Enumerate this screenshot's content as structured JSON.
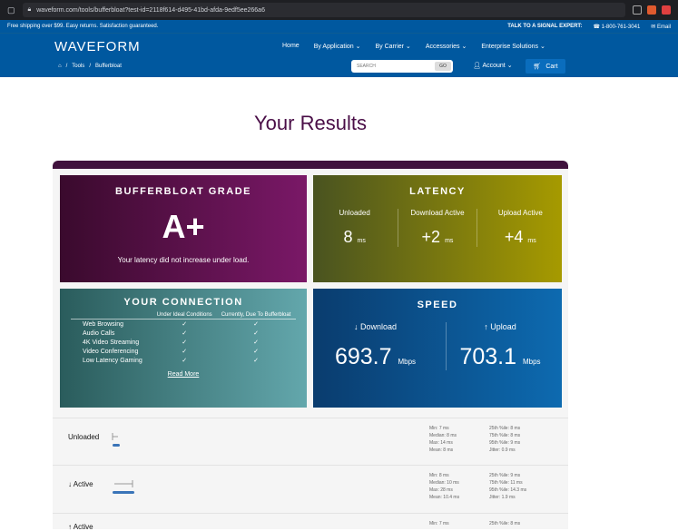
{
  "browser": {
    "url": "waveform.com/tools/bufferbloat?test-id=2118f614-d495-41bd-afda-9edf5ee266a6"
  },
  "promo": {
    "left": "Free shipping over $99. Easy returns. Satisfaction guaranteed.",
    "talk": "TALK TO A SIGNAL EXPERT:",
    "phone": "1-800-761-3041",
    "email": "Email"
  },
  "nav": {
    "logo": "WAVEFORM",
    "items": [
      "Home",
      "By Application ⌄",
      "By Carrier ⌄",
      "Accessories ⌄",
      "Enterprise Solutions ⌄"
    ],
    "breadcrumbs": [
      "⌂",
      "/",
      "Tools",
      "/",
      "Bufferbloat"
    ],
    "search_placeholder": "SEARCH",
    "search_btn": "GO",
    "account": "Account ⌄",
    "cart": "Cart"
  },
  "page": {
    "title": "Your Results"
  },
  "grade": {
    "title": "BUFFERBLOAT GRADE",
    "value": "A+",
    "subtitle": "Your latency did not increase under load."
  },
  "latency": {
    "title": "LATENCY",
    "cols": [
      {
        "label": "Unloaded",
        "value": "8",
        "unit": "ms"
      },
      {
        "label": "Download Active",
        "value": "+2",
        "unit": "ms"
      },
      {
        "label": "Upload Active",
        "value": "+4",
        "unit": "ms"
      }
    ]
  },
  "connection": {
    "title": "YOUR CONNECTION",
    "col1": "Under Ideal Conditions",
    "col2": "Currently, Due To Bufferbloat",
    "rows": [
      {
        "label": "Web Browsing",
        "a": "✓",
        "b": "✓"
      },
      {
        "label": "Audio Calls",
        "a": "✓",
        "b": "✓"
      },
      {
        "label": "4K Video Streaming",
        "a": "✓",
        "b": "✓"
      },
      {
        "label": "Video Conferencing",
        "a": "✓",
        "b": "✓"
      },
      {
        "label": "Low Latency Gaming",
        "a": "✓",
        "b": "✓"
      }
    ],
    "read_more": "Read More"
  },
  "speed": {
    "title": "SPEED",
    "download_label": "↓ Download",
    "download_value": "693.7",
    "upload_label": "↑ Upload",
    "upload_value": "703.1",
    "unit": "Mbps"
  },
  "stats": [
    {
      "name": "Unloaded",
      "left": [
        "Min: 7 ms",
        "Median: 8 ms",
        "Max: 14 ms",
        "Mean: 8 ms"
      ],
      "right": [
        "25th %ile: 8 ms",
        "75th %ile: 8 ms",
        "95th %ile: 9 ms",
        "Jitter: 0.9 ms"
      ]
    },
    {
      "name": "↓ Active",
      "left": [
        "Min: 8 ms",
        "Median: 10 ms",
        "Max: 28 ms",
        "Mean: 10.4 ms"
      ],
      "right": [
        "25th %ile: 9 ms",
        "75th %ile: 11 ms",
        "95th %ile: 14.3 ms",
        "Jitter: 1.9 ms"
      ]
    },
    {
      "name": "↑ Active",
      "left": [
        "Min: 7 ms"
      ],
      "right": [
        "25th %ile: 8 ms"
      ]
    }
  ]
}
